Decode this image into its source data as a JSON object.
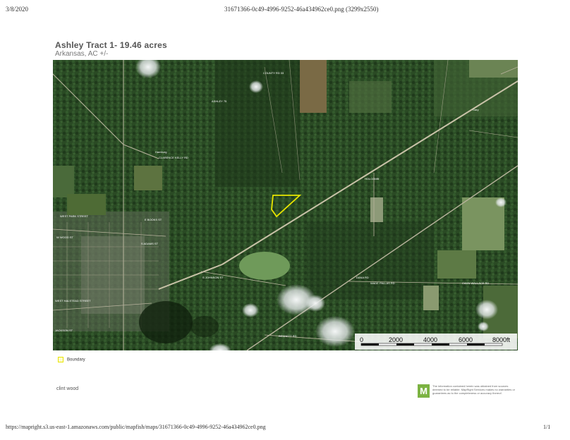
{
  "header": {
    "date": "3/8/2020",
    "filename": "31671366-0c49-4996-9252-46a434962ce0.png (3299x2550)"
  },
  "footer": {
    "url": "https://mapright.s3.us-east-1.amazonaws.com/public/mapfish/maps/31671366-0c49-4996-9252-46a434962ce0.png",
    "page": "1/1"
  },
  "map": {
    "title": "Ashley Tract 1- 19.46 acres",
    "subtitle": "Arkansas, AC +/-",
    "scale": {
      "labels": [
        "0",
        "2000",
        "4000",
        "6000",
        "8000ft"
      ]
    },
    "legend": {
      "boundary_label": "Boundary",
      "boundary_color": "#e8e500"
    },
    "roads": [
      "CLARENCE KELLY RD",
      "WEST PARK STREET",
      "E BOOKS ST",
      "W WOOD ST",
      "S JOHNSON ST",
      "S ADAMS ST",
      "WEST HALSTEAD STREET",
      "JACKSON ST",
      "BENNETT RD",
      "WADE PALLAS RD",
      "CAHN WALLACE RD",
      "DANA RD",
      "HOLCOMB",
      "ASHLEY 75",
      "COUNTY RD 33"
    ],
    "place_labels": [
      "Hamburg",
      "Gary"
    ]
  },
  "author": "clint wood",
  "branding": {
    "logo_letter": "M",
    "logo_color": "#7cb342",
    "disclaimer": "The information contained herein was obtained from sources deemed to be reliable. MapRight Services makes no warranties or guarantees as to the completeness or accuracy thereof."
  }
}
